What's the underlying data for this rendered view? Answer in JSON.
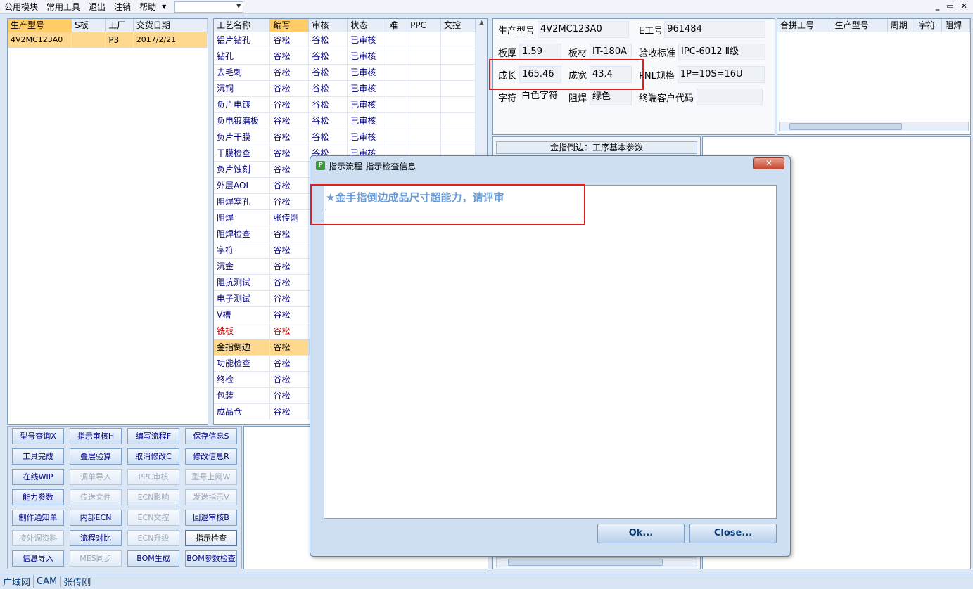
{
  "menu": {
    "items": [
      "公用模块",
      "常用工具",
      "退出",
      "注销",
      "帮助"
    ],
    "combo_value": ""
  },
  "window_controls": [
    "_",
    "▭",
    "✕"
  ],
  "orders": {
    "headers": [
      "生产型号",
      "S板",
      "工厂",
      "交货日期"
    ],
    "rows": [
      [
        "4V2MC123A0",
        "",
        "P3",
        "2017/2/21"
      ]
    ]
  },
  "process": {
    "headers": [
      "工艺名称",
      "编写",
      "审核",
      "状态",
      "难",
      "PPC",
      "文控"
    ],
    "rows": [
      [
        "铝片钻孔",
        "谷松",
        "谷松",
        "已审核"
      ],
      [
        "钻孔",
        "谷松",
        "谷松",
        "已审核"
      ],
      [
        "去毛刺",
        "谷松",
        "谷松",
        "已审核"
      ],
      [
        "沉铜",
        "谷松",
        "谷松",
        "已审核"
      ],
      [
        "负片电镀",
        "谷松",
        "谷松",
        "已审核"
      ],
      [
        "负电镀磨板",
        "谷松",
        "谷松",
        "已审核"
      ],
      [
        "负片干膜",
        "谷松",
        "谷松",
        "已审核"
      ],
      [
        "干膜检查",
        "谷松",
        "谷松",
        "已审核"
      ],
      [
        "负片蚀刻",
        "谷松",
        "",
        ""
      ],
      [
        "外层AOI",
        "谷松",
        "",
        ""
      ],
      [
        "阻焊塞孔",
        "谷松",
        "",
        ""
      ],
      [
        "阻焊",
        "张传刚",
        "",
        ""
      ],
      [
        "阻焊检查",
        "谷松",
        "",
        ""
      ],
      [
        "字符",
        "谷松",
        "",
        ""
      ],
      [
        "沉金",
        "谷松",
        "",
        ""
      ],
      [
        "阻抗测试",
        "谷松",
        "",
        ""
      ],
      [
        "电子测试",
        "谷松",
        "",
        ""
      ],
      [
        "V槽",
        "谷松",
        "",
        ""
      ],
      [
        "铣板",
        "谷松",
        "",
        ""
      ],
      [
        "金指倒边",
        "谷松",
        "",
        ""
      ],
      [
        "功能检查",
        "谷松",
        "",
        ""
      ],
      [
        "终检",
        "谷松",
        "",
        ""
      ],
      [
        "包装",
        "谷松",
        "",
        ""
      ],
      [
        "成品仓",
        "谷松",
        "",
        ""
      ]
    ],
    "selected_index": 19,
    "red_index": 18
  },
  "info": {
    "model_label": "生产型号",
    "model_value": "4V2MC123A0",
    "e_label": "E工号",
    "e_value": "961484",
    "thick_label": "板厚",
    "thick_value": "1.59",
    "material_label": "板材",
    "material_value": "IT-180A",
    "std_label": "验收标准",
    "std_value": "IPC-6012 Ⅱ级",
    "len_label": "成长",
    "len_value": "165.46",
    "wid_label": "成宽",
    "wid_value": "43.4",
    "pnl_label": "PNL规格",
    "pnl_value": "1P=10S=16U",
    "char_label": "字符",
    "char_value": "白色字符",
    "mask_label": "阻焊",
    "mask_value": "绿色",
    "cust_label": "终端客户代码",
    "cust_value": ""
  },
  "merge": {
    "headers": [
      "合拼工号",
      "生产型号",
      "周期",
      "字符",
      "阻焊"
    ]
  },
  "step_params": {
    "title": "金指倒边：工序基本参数"
  },
  "buttons": [
    [
      "型号查询X",
      "指示审核H",
      "编写流程F",
      "保存信息S"
    ],
    [
      "工具完成",
      "叠层验算",
      "取消修改C",
      "修改信息R"
    ],
    [
      "在线WIP",
      "调单导入",
      "PPC审核",
      "型号上网W"
    ],
    [
      "能力参数",
      "传送文件",
      "ECN影响",
      "发送指示V"
    ],
    [
      "制作通知单",
      "内部ECN",
      "ECN文控",
      "回退审核B"
    ],
    [
      "接外调资料",
      "流程对比",
      "ECN升级",
      "指示检查"
    ],
    [
      "信息导入",
      "MES同步",
      "BOM生成",
      "BOM参数检查"
    ]
  ],
  "dialog": {
    "title": "指示流程-指示检查信息",
    "message": "★金手指倒边成品尺寸超能力，请评审",
    "ok": "Ok...",
    "close": "Close..."
  },
  "status": [
    "广域网",
    "CAM",
    "张传刚"
  ]
}
